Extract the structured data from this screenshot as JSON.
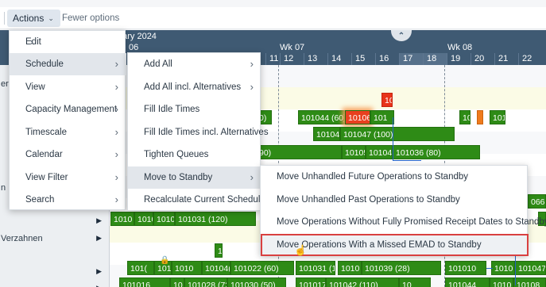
{
  "toolbar": {
    "actions_label": "Actions",
    "fewer_options_label": "Fewer options"
  },
  "gantt": {
    "month_label": "uary 2024",
    "day06": "06",
    "weeks": [
      "Wk 07",
      "Wk 08"
    ],
    "days": [
      "11",
      "12",
      "13",
      "14",
      "15",
      "16",
      "17",
      "18",
      "19",
      "20",
      "21",
      "22"
    ],
    "rows_left": [
      {
        "label": "er"
      },
      {
        "label": ""
      },
      {
        "label": ""
      },
      {
        "label": ""
      },
      {
        "label": "n"
      },
      {
        "label": ""
      },
      {
        "label": ""
      },
      {
        "label": "Verzahnen"
      },
      {
        "label": ""
      },
      {
        "label": ""
      }
    ],
    "bars": {
      "b1": "10",
      "b2": "0)",
      "b3": "101044 (60)",
      "b4": "10106",
      "b5": "101",
      "b6": "10",
      "b7": "101",
      "b8": "101041",
      "b9": "101047 (100)",
      "b10": "90)",
      "b11": "10105",
      "b12": "101049",
      "b13": "101036 (80)",
      "b14": "066",
      "b15": "1010",
      "b16": "1010",
      "b17": "1010",
      "b18": "101031 (120)",
      "b19": "1",
      "b20": "101(",
      "b21": "1010",
      "b22": "1010",
      "b23": "10104(",
      "b24": "101022 (60)",
      "b25": "101031 (1",
      "b26": "1010",
      "b27": "101039 (28)",
      "b28": "101010",
      "b29": "1010",
      "b30": "101047",
      "b31": "101016",
      "b32": "10",
      "b33": "101028 (72)",
      "b34": "101030 (50)",
      "b35": "101017",
      "b36": "101042 (110)",
      "b37": "10",
      "b38": "101044",
      "b39": "1010",
      "b40": "10108"
    }
  },
  "menu1": {
    "items": [
      {
        "label": "Edit"
      },
      {
        "label": "Schedule"
      },
      {
        "label": "View"
      },
      {
        "label": "Capacity Management"
      },
      {
        "label": "Timescale"
      },
      {
        "label": "Calendar"
      },
      {
        "label": "View Filter"
      },
      {
        "label": "Search"
      }
    ]
  },
  "menu2": {
    "items": [
      {
        "label": "Add All"
      },
      {
        "label": "Add All incl. Alternatives"
      },
      {
        "label": "Fill Idle Times"
      },
      {
        "label": "Fill Idle Times incl. Alternatives"
      },
      {
        "label": "Tighten Queues"
      },
      {
        "label": "Move to Standby"
      },
      {
        "label": "Recalculate Current Schedule"
      }
    ]
  },
  "menu3": {
    "items": [
      {
        "label": "Move Unhandled Future Operations to Standby"
      },
      {
        "label": "Move Unhandled Past Operations to Standby"
      },
      {
        "label": "Move Operations Without Fully Promised Receipt Dates to Standby"
      },
      {
        "label": "Move Operations With a Missed EMAD to Standby"
      }
    ]
  },
  "colors": {
    "header": "#3f5a73",
    "bar_green": "#2e8b16",
    "bar_red": "#e8331b",
    "bar_orange": "#ef7b1d",
    "highlight_outline": "#d94040"
  }
}
